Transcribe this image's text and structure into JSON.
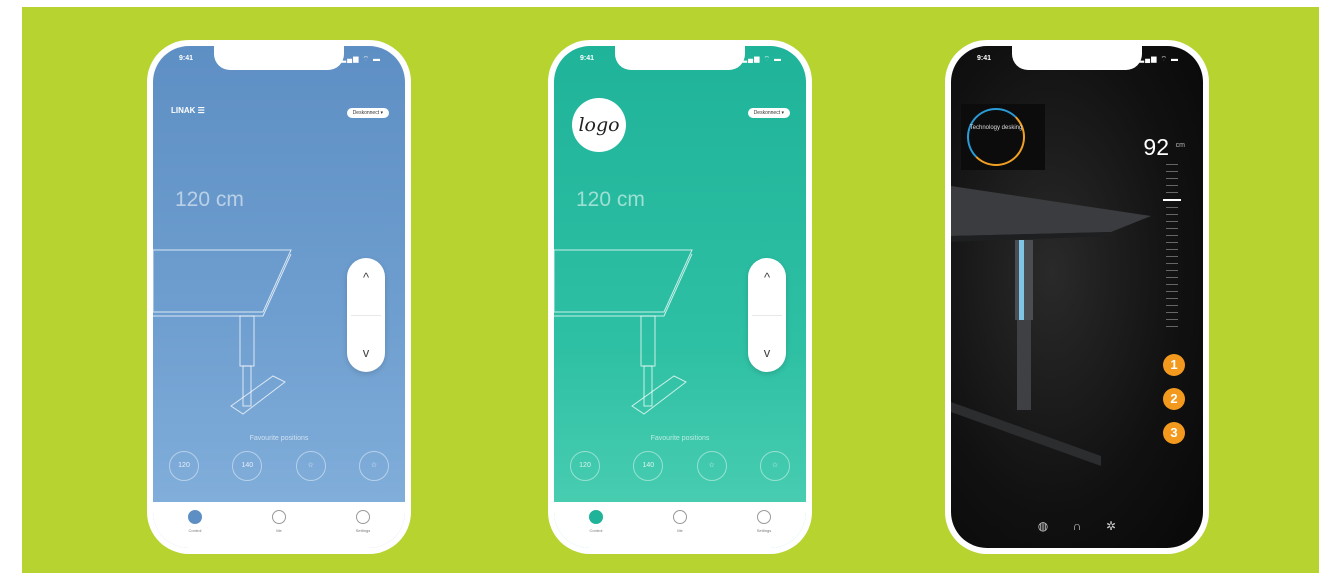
{
  "phones": [
    {
      "status": {
        "time": "9:41",
        "icons": "▂▄▆ ⌔ ▬"
      },
      "brand": "LINAK ☰",
      "pill": "Deskonnect ▾",
      "height": "120 cm",
      "up_arrow": "^",
      "down_arrow": "v",
      "favourites_label": "Favourite positions",
      "favourites": [
        "120",
        "140",
        "☆",
        "☆"
      ],
      "tabs": [
        {
          "label": "Control"
        },
        {
          "label": "Me"
        },
        {
          "label": "Settings"
        }
      ],
      "accent": "#5e8fc4"
    },
    {
      "status": {
        "time": "9:41",
        "icons": "▂▄▆ ⌔ ▬"
      },
      "logo": "logo",
      "pill": "Deskonnect ▾",
      "height": "120 cm",
      "up_arrow": "^",
      "down_arrow": "v",
      "favourites_label": "Favourite positions",
      "favourites": [
        "120",
        "140",
        "☆",
        "☆"
      ],
      "tabs": [
        {
          "label": "Control"
        },
        {
          "label": "Me"
        },
        {
          "label": "Settings"
        }
      ],
      "accent": "#1fb39a"
    },
    {
      "status": {
        "time": "9:41",
        "icons": "▂▄▆ ⌔ ▬"
      },
      "badge_text": "Technology desking",
      "height_value": "92",
      "height_unit": "cm",
      "presets": [
        "1",
        "2",
        "3"
      ],
      "bottom_icons": [
        "globe-icon",
        "headset-icon",
        "gear-icon"
      ],
      "accent": "#f39a1e"
    }
  ],
  "background_color": "#b6d330"
}
